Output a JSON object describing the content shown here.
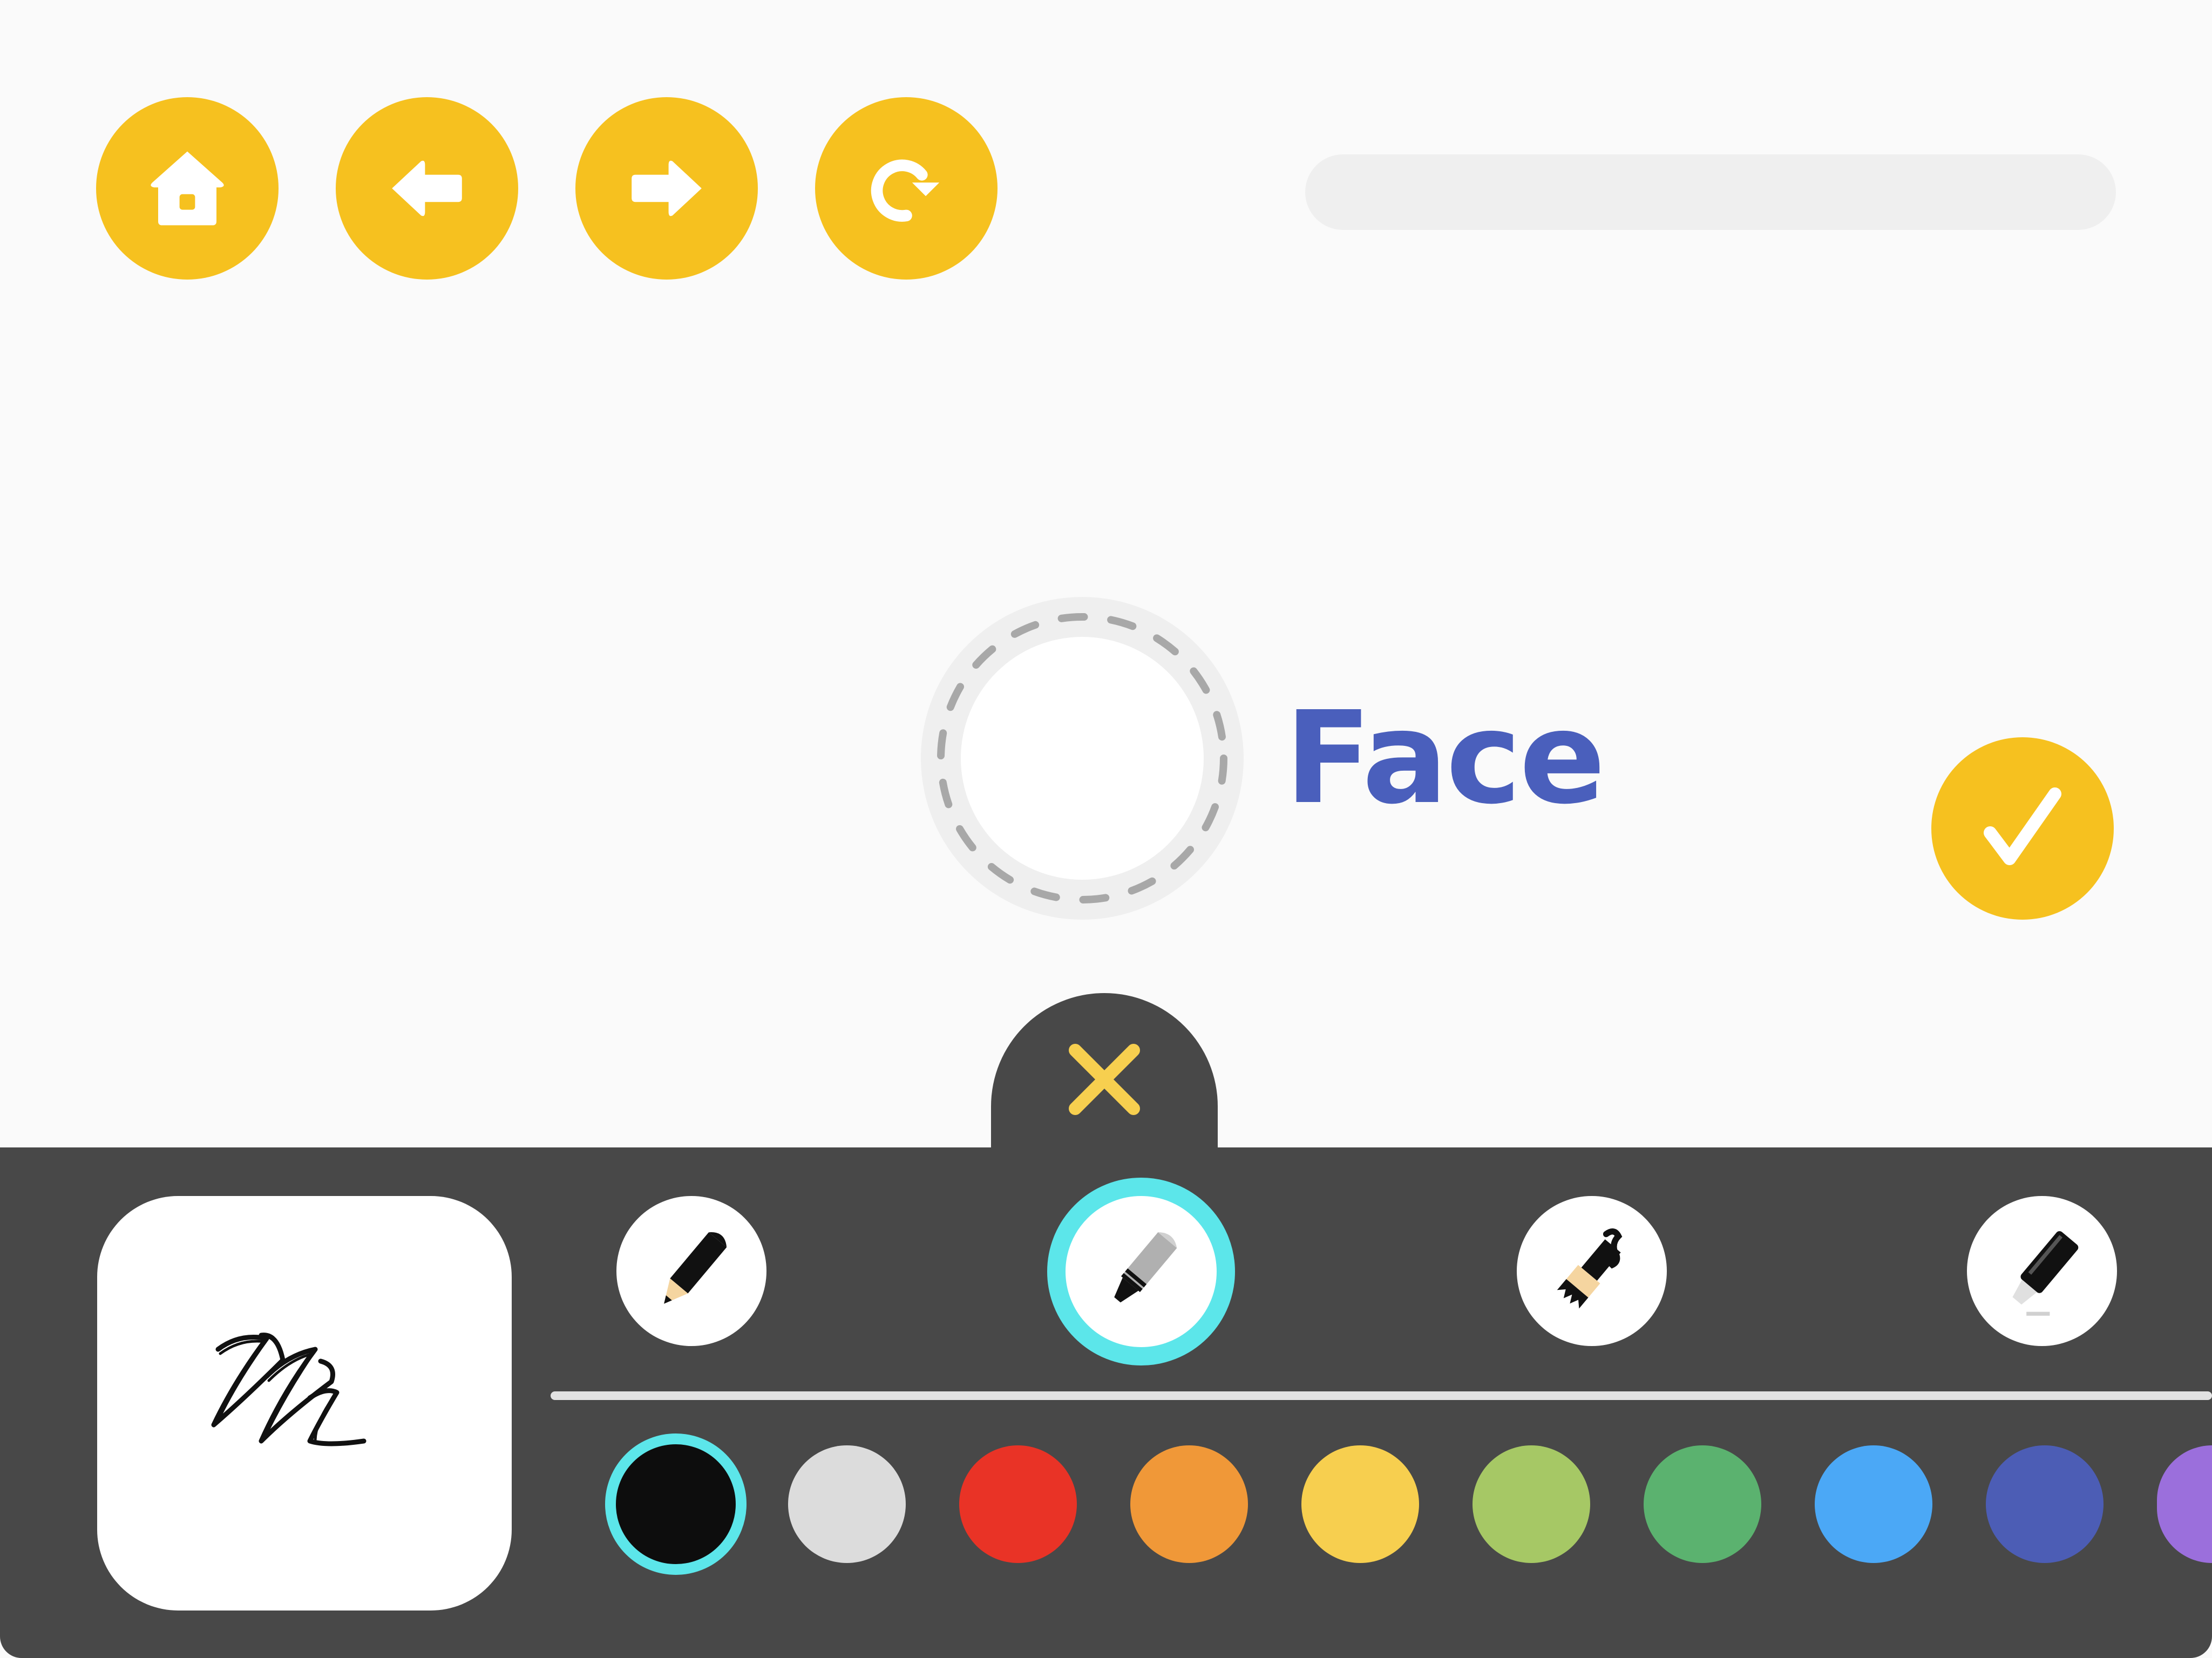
{
  "toolbar": {
    "buttons": [
      {
        "name": "home-button",
        "icon": "home-icon"
      },
      {
        "name": "back-button",
        "icon": "arrow-left-icon"
      },
      {
        "name": "forward-button",
        "icon": "arrow-right-icon"
      },
      {
        "name": "refresh-button",
        "icon": "refresh-icon"
      }
    ],
    "progress": 0.0
  },
  "target": {
    "label": "Face"
  },
  "confirm": {
    "icon": "checkmark-icon"
  },
  "drawing_panel": {
    "close_icon": "close-icon",
    "preview_icon": "stroke-preview-icon",
    "tools": [
      {
        "name": "pencil",
        "icon": "pencil-icon",
        "selected": false
      },
      {
        "name": "crayon",
        "icon": "crayon-icon",
        "selected": true
      },
      {
        "name": "paintbrush",
        "icon": "paintbrush-icon",
        "selected": false
      },
      {
        "name": "marker",
        "icon": "marker-icon",
        "selected": false
      }
    ],
    "selected_color": "#0d0d0d",
    "palette": [
      {
        "name": "black",
        "hex": "#0d0d0d"
      },
      {
        "name": "light-gray",
        "hex": "#dcdcdc"
      },
      {
        "name": "red",
        "hex": "#e93326"
      },
      {
        "name": "orange",
        "hex": "#f09838"
      },
      {
        "name": "yellow",
        "hex": "#f7cf4f"
      },
      {
        "name": "yellow-green",
        "hex": "#a6c865"
      },
      {
        "name": "green",
        "hex": "#5bb26f"
      },
      {
        "name": "blue",
        "hex": "#4ba8f6"
      },
      {
        "name": "indigo",
        "hex": "#4c5db5"
      },
      {
        "name": "purple",
        "hex": "#9b6fdc"
      }
    ]
  },
  "colors": {
    "accent": "#f6c11f",
    "selection": "#5ce6ea",
    "label_text": "#4a5fbc",
    "panel": "#484848",
    "close_x": "#f7cf4f",
    "slot_dash": "#a8a8a8"
  }
}
